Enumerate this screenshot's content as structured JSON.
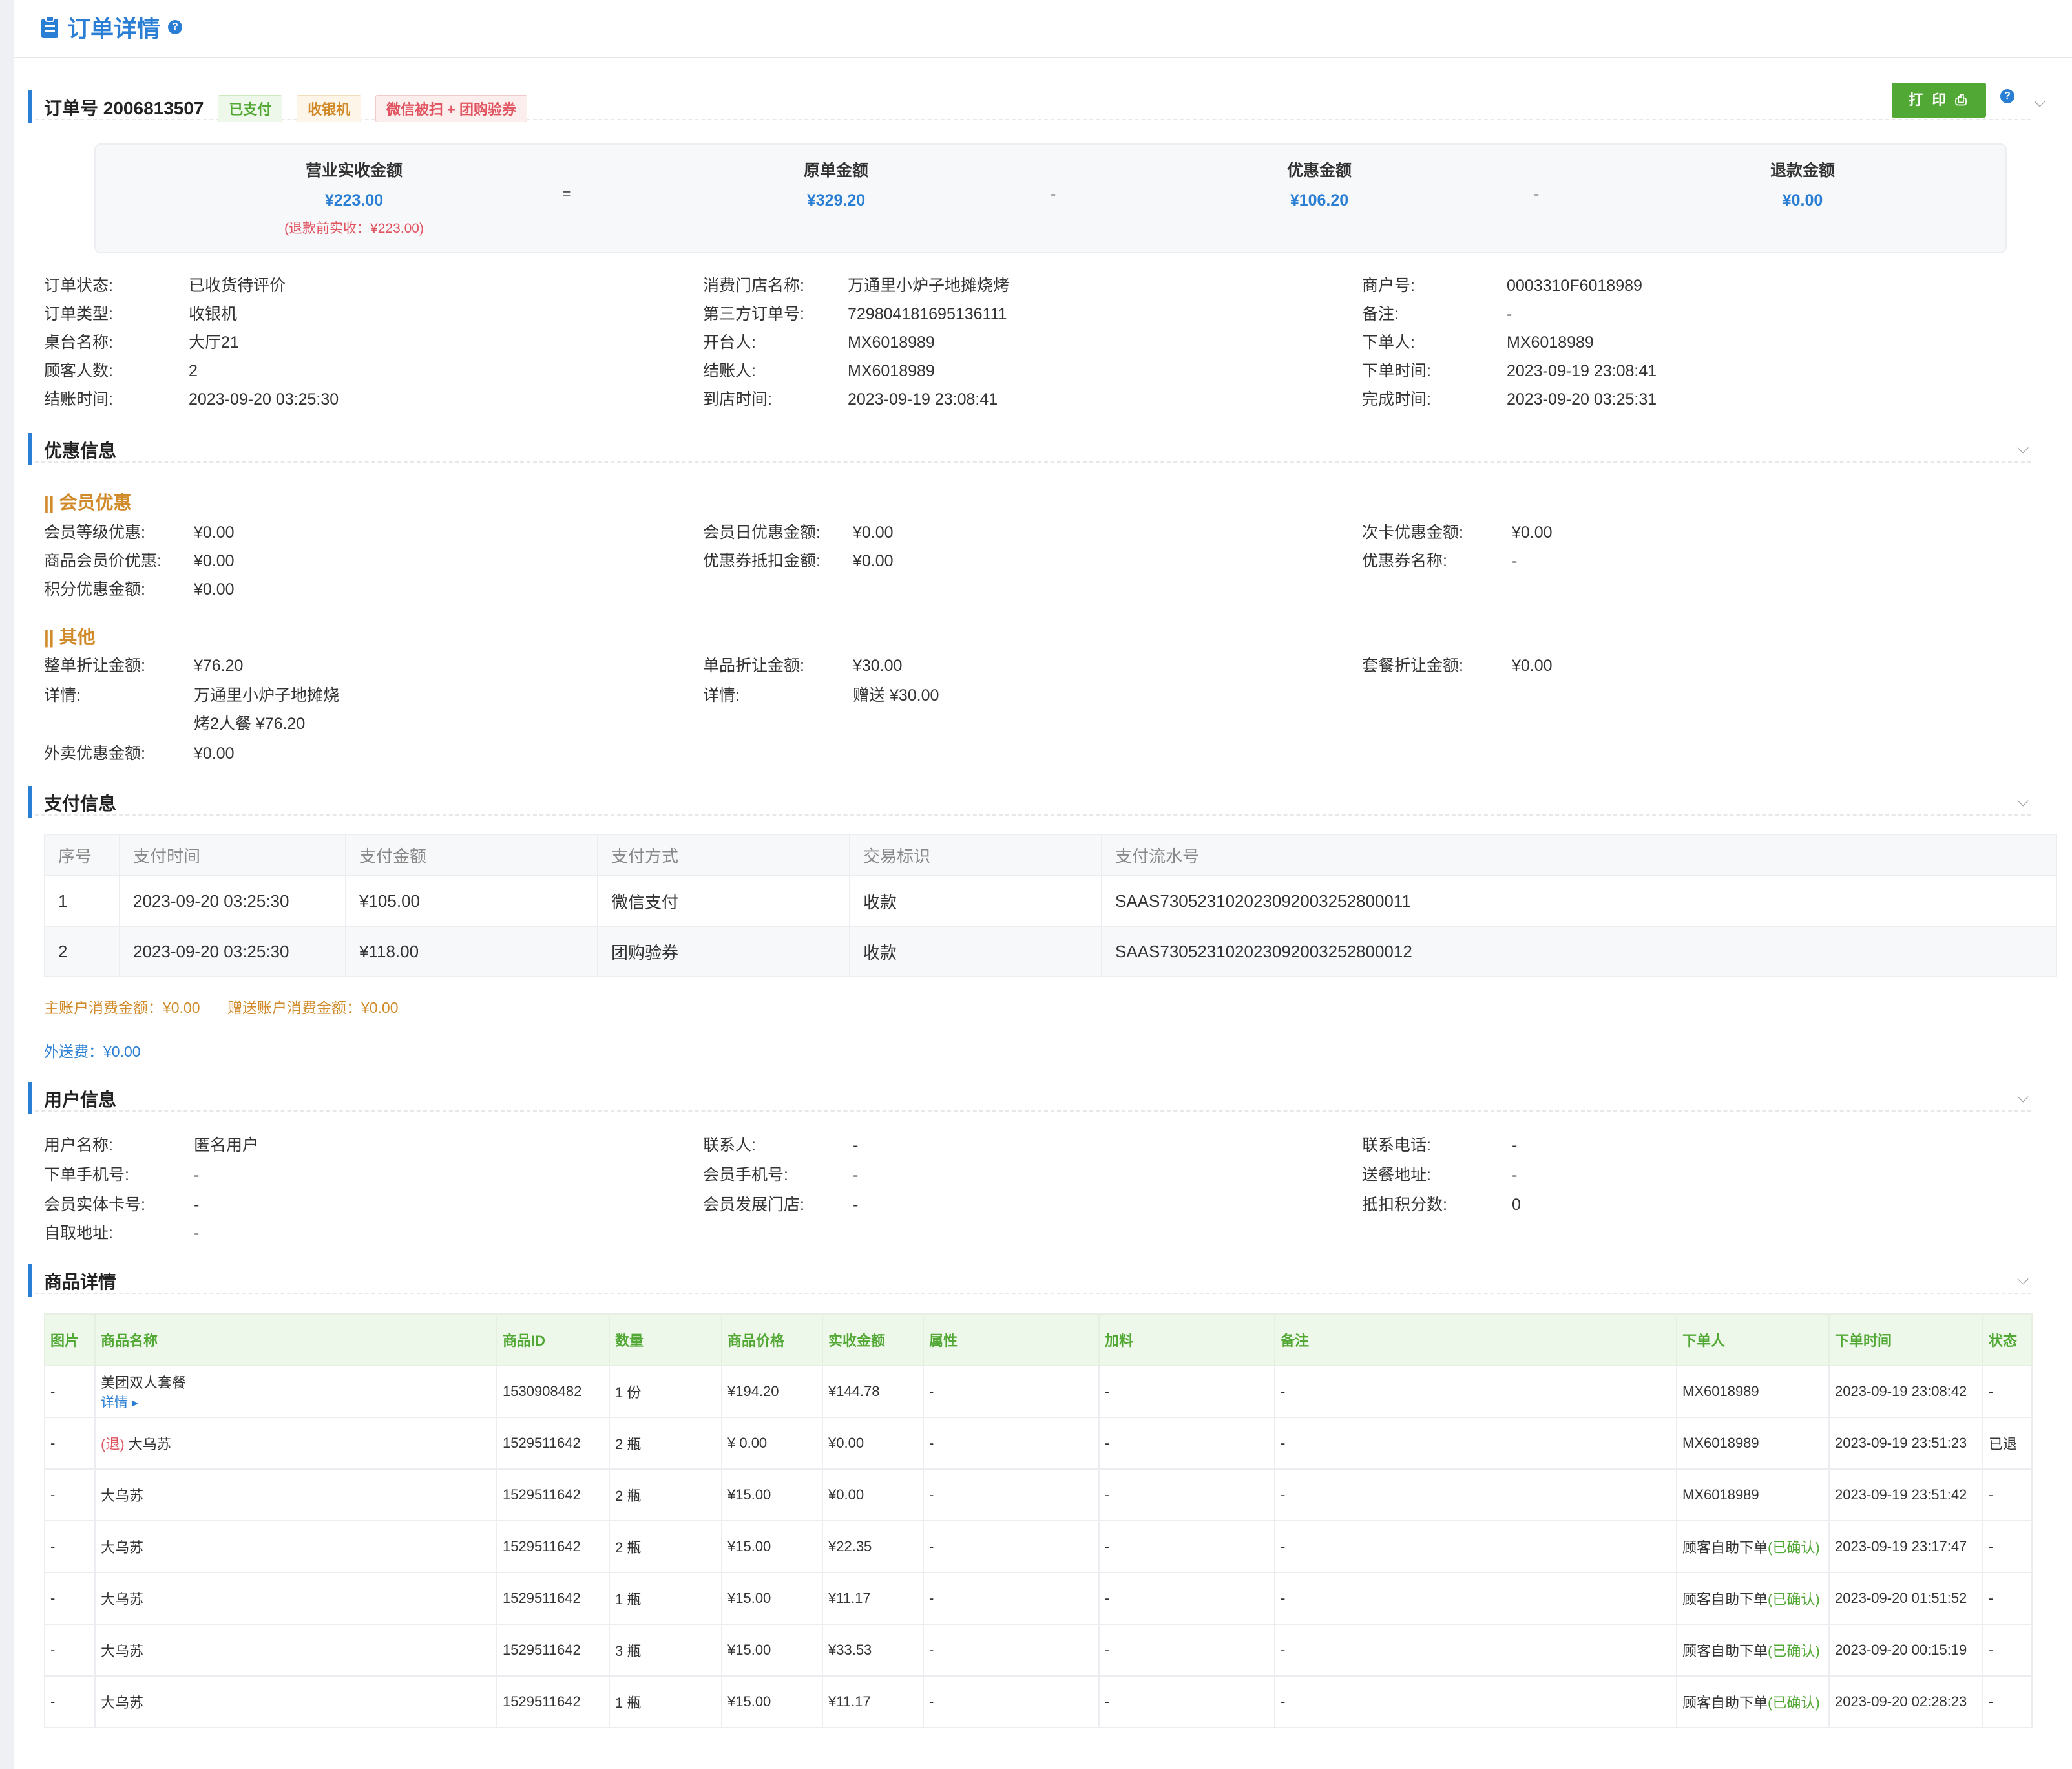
{
  "page": {
    "title": "订单详情"
  },
  "order": {
    "title": "订单号 2006813507",
    "tags": [
      "已支付",
      "收银机",
      "微信被扫 + 团购验券"
    ],
    "print_label": "打 印 ⎙"
  },
  "summary": {
    "actual_label": "营业实收金额",
    "actual_value": "¥223.00",
    "actual_sub": "(退款前实收：¥223.00)",
    "op1": "=",
    "original_label": "原单金额",
    "original_value": "¥329.20",
    "op2": "-",
    "discount_label": "优惠金额",
    "discount_value": "¥106.20",
    "op3": "-",
    "refund_label": "退款金额",
    "refund_value": "¥0.00"
  },
  "order_info": {
    "col1": [
      {
        "k": "订单状态:",
        "v": "已收货待评价"
      },
      {
        "k": "订单类型:",
        "v": "收银机"
      },
      {
        "k": "桌台名称:",
        "v": "大厅21"
      },
      {
        "k": "顾客人数:",
        "v": "2"
      },
      {
        "k": "结账时间:",
        "v": "2023-09-20 03:25:30"
      }
    ],
    "col2": [
      {
        "k": "消费门店名称:",
        "v": "万通里小炉子地摊烧烤"
      },
      {
        "k": "第三方订单号:",
        "v": "729804181695136111"
      },
      {
        "k": "开台人:",
        "v": "MX6018989"
      },
      {
        "k": "结账人:",
        "v": "MX6018989"
      },
      {
        "k": "到店时间:",
        "v": "2023-09-19 23:08:41"
      }
    ],
    "col3": [
      {
        "k": "商户号:",
        "v": "0003310F6018989"
      },
      {
        "k": "备注:",
        "v": "-"
      },
      {
        "k": "下单人:",
        "v": "MX6018989"
      },
      {
        "k": "下单时间:",
        "v": "2023-09-19 23:08:41"
      },
      {
        "k": "完成时间:",
        "v": "2023-09-20 03:25:31"
      }
    ]
  },
  "discount": {
    "title": "优惠信息",
    "member_title": "|| 会员优惠",
    "member_col1": [
      {
        "k": "会员等级优惠:",
        "v": "¥0.00"
      },
      {
        "k": "商品会员价优惠:",
        "v": "¥0.00"
      },
      {
        "k": "积分优惠金额:",
        "v": "¥0.00"
      }
    ],
    "member_col2": [
      {
        "k": "会员日优惠金额:",
        "v": "¥0.00"
      },
      {
        "k": "优惠券抵扣金额:",
        "v": "¥0.00"
      }
    ],
    "member_col3": [
      {
        "k": "次卡优惠金额:",
        "v": "¥0.00"
      },
      {
        "k": "优惠券名称:",
        "v": "-"
      }
    ],
    "other_title": "|| 其他",
    "whole_k": "整单折让金额:",
    "whole_v": "¥76.20",
    "detail_k": "详情:",
    "detail_v1": "万通里小炉子地摊烧",
    "detail_v2": "烤2人餐 ¥76.20",
    "takeout_k": "外卖优惠金额:",
    "takeout_v": "¥0.00",
    "single_k": "单品折让金额:",
    "single_v": "¥30.00",
    "single_detail_k": "详情:",
    "single_detail_v": "赠送 ¥30.00",
    "combo_k": "套餐折让金额:",
    "combo_v": "¥0.00"
  },
  "payment": {
    "title": "支付信息",
    "headers": [
      "序号",
      "支付时间",
      "支付金额",
      "支付方式",
      "交易标识",
      "支付流水号"
    ],
    "rows": [
      [
        "1",
        "2023-09-20 03:25:30",
        "¥105.00",
        "微信支付",
        "收款",
        "SAAS730523102023092003252800011"
      ],
      [
        "2",
        "2023-09-20 03:25:30",
        "¥118.00",
        "团购验券",
        "收款",
        "SAAS730523102023092003252800012"
      ]
    ],
    "main_account": "主账户消费金额：¥0.00",
    "gift_account": "赠送账户消费金额：¥0.00",
    "delivery_fee": "外送费：¥0.00"
  },
  "user": {
    "title": "用户信息",
    "col1": [
      {
        "k": "用户名称:",
        "v": "匿名用户"
      },
      {
        "k": "下单手机号:",
        "v": "-"
      },
      {
        "k": "会员实体卡号:",
        "v": "-"
      },
      {
        "k": "自取地址:",
        "v": "-"
      }
    ],
    "col2": [
      {
        "k": "联系人:",
        "v": "-"
      },
      {
        "k": "会员手机号:",
        "v": "-"
      },
      {
        "k": "会员发展门店:",
        "v": "-"
      }
    ],
    "col3": [
      {
        "k": "联系电话:",
        "v": "-"
      },
      {
        "k": "送餐地址:",
        "v": "-"
      },
      {
        "k": "抵扣积分数:",
        "v": "0"
      }
    ]
  },
  "goods": {
    "title": "商品详情",
    "headers": [
      "图片",
      "商品名称",
      "商品ID",
      "数量",
      "商品价格",
      "实收金额",
      "属性",
      "加料",
      "备注",
      "下单人",
      "下单时间",
      "状态"
    ],
    "detail_link": "详情 ▸",
    "refund_mark": "(退)",
    "self_order_prefix": "顾客自助下单",
    "self_order_suffix": "(已确认)",
    "rows": [
      {
        "img": "-",
        "name": "美团双人套餐",
        "id": "1530908482",
        "qty": "1 份",
        "price": "¥194.20",
        "actual": "¥144.78",
        "attr": "-",
        "extra": "-",
        "note": "-",
        "orderer": "MX6018989",
        "time": "2023-09-19 23:08:42",
        "status": "-"
      },
      {
        "img": "-",
        "name": "大乌苏",
        "id": "1529511642",
        "qty": "2 瓶",
        "price": "¥ 0.00",
        "actual": "¥0.00",
        "attr": "-",
        "extra": "-",
        "note": "-",
        "orderer": "MX6018989",
        "time": "2023-09-19 23:51:23",
        "status": "已退"
      },
      {
        "img": "-",
        "name": "大乌苏",
        "id": "1529511642",
        "qty": "2 瓶",
        "price": "¥15.00",
        "actual": "¥0.00",
        "attr": "-",
        "extra": "-",
        "note": "-",
        "orderer": "MX6018989",
        "time": "2023-09-19 23:51:42",
        "status": "-"
      },
      {
        "img": "-",
        "name": "大乌苏",
        "id": "1529511642",
        "qty": "2 瓶",
        "price": "¥15.00",
        "actual": "¥22.35",
        "attr": "-",
        "extra": "-",
        "note": "-",
        "orderer": "",
        "time": "2023-09-19 23:17:47",
        "status": "-"
      },
      {
        "img": "-",
        "name": "大乌苏",
        "id": "1529511642",
        "qty": "1 瓶",
        "price": "¥15.00",
        "actual": "¥11.17",
        "attr": "-",
        "extra": "-",
        "note": "-",
        "orderer": "",
        "time": "2023-09-20 01:51:52",
        "status": "-"
      },
      {
        "img": "-",
        "name": "大乌苏",
        "id": "1529511642",
        "qty": "3 瓶",
        "price": "¥15.00",
        "actual": "¥33.53",
        "attr": "-",
        "extra": "-",
        "note": "-",
        "orderer": "",
        "time": "2023-09-20 00:15:19",
        "status": "-"
      },
      {
        "img": "-",
        "name": "大乌苏",
        "id": "1529511642",
        "qty": "1 瓶",
        "price": "¥15.00",
        "actual": "¥11.17",
        "attr": "-",
        "extra": "-",
        "note": "-",
        "orderer": "",
        "time": "2023-09-20 02:28:23",
        "status": "-"
      }
    ]
  },
  "colors": {
    "accent": "#2a7fd4",
    "green": "#52a835",
    "orange": "#d08a2a",
    "red": "#e0535f"
  }
}
